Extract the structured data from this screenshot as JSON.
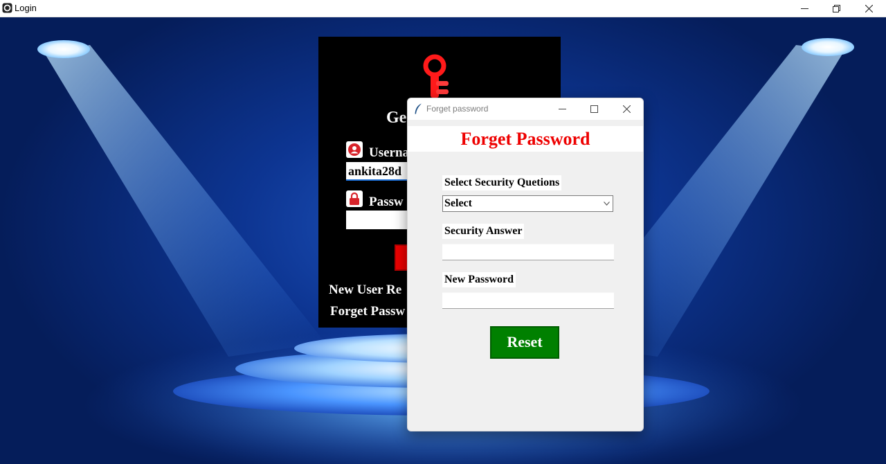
{
  "window": {
    "title": "Login",
    "icon": "app-icon",
    "controls": [
      "minimize-icon",
      "restore-icon",
      "close-icon"
    ]
  },
  "login": {
    "heading": "Ge",
    "username_label": "Userna",
    "username_value": "ankita28d",
    "password_label": "Passw",
    "password_value": "",
    "new_user_link": "New User Re",
    "forget_link": "Forget Passw"
  },
  "dialog": {
    "title": "Forget password",
    "header": "Forget Password",
    "security_question_label": "Select Security Quetions",
    "security_question_value": "Select",
    "security_answer_label": "Security Answer",
    "security_answer_value": "",
    "new_password_label": "New Password",
    "new_password_value": "",
    "reset_label": "Reset"
  },
  "colors": {
    "header_red": "#ee0000",
    "reset_green": "#008000",
    "stage_blue": "#0d3592"
  }
}
